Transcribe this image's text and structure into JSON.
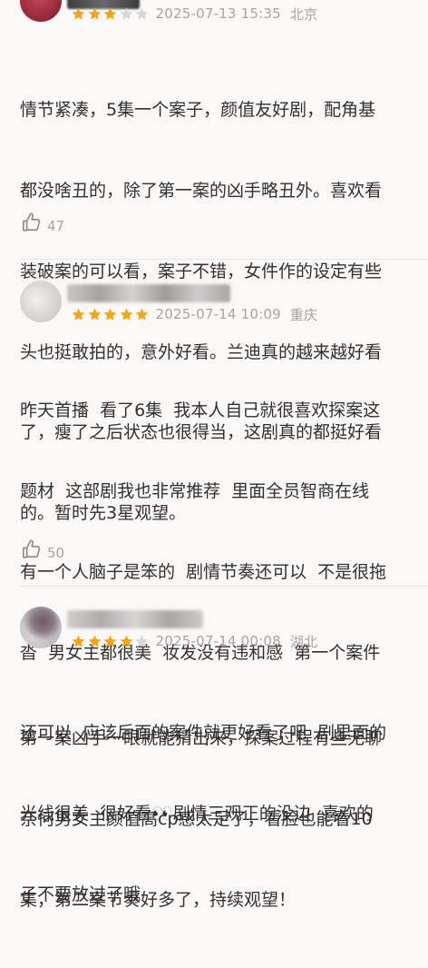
{
  "colors": {
    "star_on": "#f4a416",
    "star_off": "#dcd7d7",
    "meta_text": "#a9a4a4",
    "body_text": "#303030",
    "background": "#fbf8f8"
  },
  "reviews": [
    {
      "rating": 3,
      "date": "2025-07-13 15:35",
      "location": "北京",
      "lines": [
        "情节紧凑，5集一个案子，颜值友好剧，配角基",
        "都没啥丑的，除了第一案的凶手略丑外。喜欢看",
        "装破案的可以看，案子不错，女件作的设定有些",
        "头也挺敢拍的，意外好看。兰迪真的越来越好看",
        "了，瘦了之后状态也很得当，这剧真的都挺好看",
        "的。暂时先3星观望。"
      ],
      "likes": "47",
      "like_icon": "thumbs-up-icon"
    },
    {
      "rating": 5,
      "date": "2025-07-14 10:09",
      "location": "重庆",
      "lines": [
        "昨天首播  看了6集  我本人自己就很喜欢探案这",
        "题材  这部剧我也非常推荐  里面全员智商在线",
        "有一个人脑子是笨的  剧情节奏还可以  不是很拖",
        "沓  男女主都很美  妆发没有违和感  第一个案件",
        "还可以  应该后面的案件就更好看了吧  剧里面的",
        "光线很美  很好看👀剧情三观正的没边  喜欢的",
        "子不要放过了哦"
      ],
      "likes": "50",
      "like_icon": "thumbs-up-icon"
    },
    {
      "rating": 4,
      "date": "2025-07-14 00:08",
      "location": "湖北",
      "lines": [
        "第一案凶手一眼就能猜出来，探案过程有些无聊",
        "奈何男女主颜值高cp感太足了，看脸也能看10",
        "集，第二案节奏好多了，持续观望！"
      ]
    }
  ]
}
